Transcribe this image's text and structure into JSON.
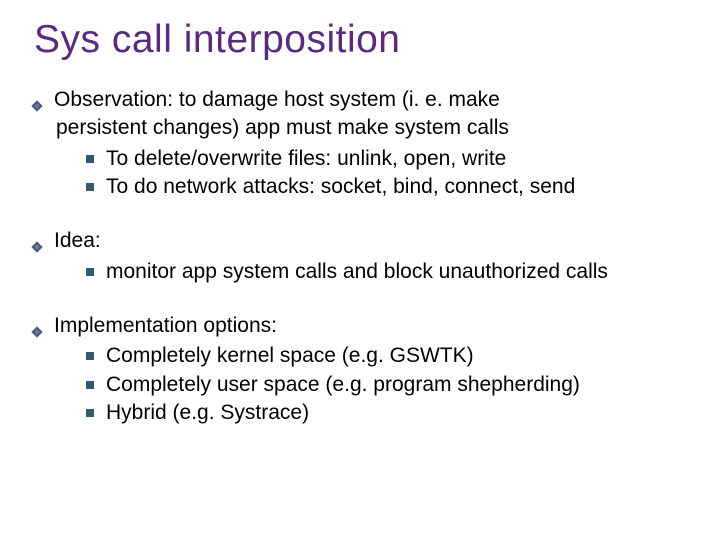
{
  "title": "Sys call interposition",
  "sections": [
    {
      "lead": "Observation:   to damage host system (i. e. make",
      "cont": "persistent changes)  app must make system calls",
      "subs": [
        "To delete/overwrite files:      unlink, open, write",
        "To do network attacks:     socket, bind, connect, send"
      ]
    },
    {
      "lead": "Idea:",
      "cont": "",
      "subs": [
        "monitor app system calls and block unauthorized calls"
      ]
    },
    {
      "lead": "Implementation options:",
      "cont": "",
      "subs": [
        "Completely kernel space (e.g. GSWTK)",
        "Completely user space (e.g.  program shepherding)",
        "Hybrid  (e.g.   Systrace)"
      ]
    }
  ]
}
